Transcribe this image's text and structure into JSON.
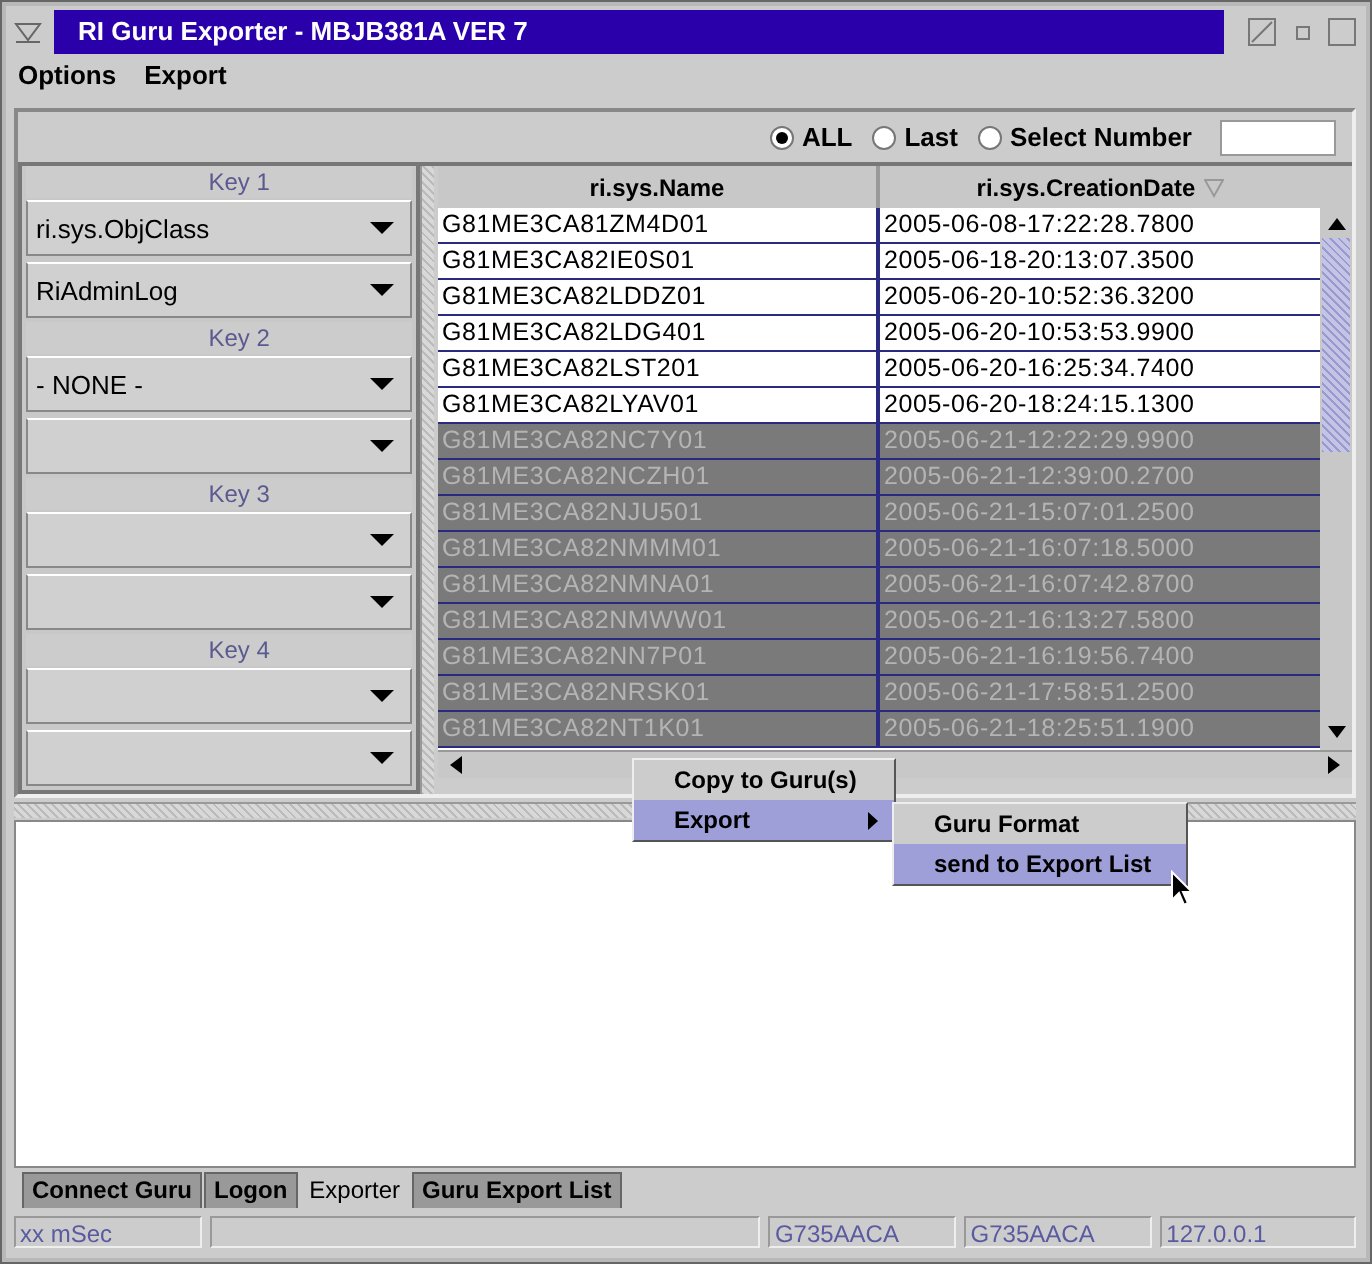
{
  "window": {
    "title": "RI Guru Exporter - MBJB381A  VER 7"
  },
  "menu_bar": [
    "Options",
    "Export"
  ],
  "filter": {
    "options": [
      {
        "label": "ALL",
        "selected": true
      },
      {
        "label": "Last",
        "selected": false
      },
      {
        "label": "Select Number",
        "selected": false
      }
    ]
  },
  "keys": [
    {
      "label": "Key 1",
      "selectors": [
        {
          "kind": "value",
          "value": "ri.sys.ObjClass"
        },
        {
          "kind": "value",
          "value": "RiAdminLog"
        }
      ]
    },
    {
      "label": "Key 2",
      "selectors": [
        {
          "kind": "value",
          "value": "- NONE -"
        },
        {
          "kind": "blank"
        }
      ]
    },
    {
      "label": "Key 3",
      "selectors": [
        {
          "kind": "blank"
        },
        {
          "kind": "blank"
        }
      ]
    },
    {
      "label": "Key 4",
      "selectors": [
        {
          "kind": "blank"
        },
        {
          "kind": "blank"
        }
      ]
    }
  ],
  "table": {
    "columns": [
      {
        "label": "ri.sys.Name",
        "sorted": false
      },
      {
        "label": "ri.sys.CreationDate",
        "sorted": true
      }
    ],
    "rows": [
      {
        "cells": [
          "G81ME3CA81ZM4D01",
          "2005-06-08-17:22:28.7800"
        ],
        "selected": false
      },
      {
        "cells": [
          "G81ME3CA82IE0S01",
          "2005-06-18-20:13:07.3500"
        ],
        "selected": false
      },
      {
        "cells": [
          "G81ME3CA82LDDZ01",
          "2005-06-20-10:52:36.3200"
        ],
        "selected": false
      },
      {
        "cells": [
          "G81ME3CA82LDG401",
          "2005-06-20-10:53:53.9900"
        ],
        "selected": false
      },
      {
        "cells": [
          "G81ME3CA82LST201",
          "2005-06-20-16:25:34.7400"
        ],
        "selected": false
      },
      {
        "cells": [
          "G81ME3CA82LYAV01",
          "2005-06-20-18:24:15.1300"
        ],
        "selected": false
      },
      {
        "cells": [
          "G81ME3CA82NC7Y01",
          "2005-06-21-12:22:29.9900"
        ],
        "selected": true
      },
      {
        "cells": [
          "G81ME3CA82NCZH01",
          "2005-06-21-12:39:00.2700"
        ],
        "selected": true
      },
      {
        "cells": [
          "G81ME3CA82NJU501",
          "2005-06-21-15:07:01.2500"
        ],
        "selected": true
      },
      {
        "cells": [
          "G81ME3CA82NMMM01",
          "2005-06-21-16:07:18.5000"
        ],
        "selected": true
      },
      {
        "cells": [
          "G81ME3CA82NMNA01",
          "2005-06-21-16:07:42.8700"
        ],
        "selected": true
      },
      {
        "cells": [
          "G81ME3CA82NMWW01",
          "2005-06-21-16:13:27.5800"
        ],
        "selected": true
      },
      {
        "cells": [
          "G81ME3CA82NN7P01",
          "2005-06-21-16:19:56.7400"
        ],
        "selected": true
      },
      {
        "cells": [
          "G81ME3CA82NRSK01",
          "2005-06-21-17:58:51.2500"
        ],
        "selected": true
      },
      {
        "cells": [
          "G81ME3CA82NT1K01",
          "2005-06-21-18:25:51.1900"
        ],
        "selected": true
      }
    ]
  },
  "context_menu": {
    "items": [
      {
        "label": "Copy to Guru(s)",
        "selected": false,
        "submenu": false
      },
      {
        "label": "Export",
        "selected": true,
        "submenu": true
      }
    ]
  },
  "submenu": {
    "items": [
      {
        "label": "Guru Format",
        "selected": false
      },
      {
        "label": "send to Export List",
        "selected": true
      }
    ]
  },
  "tabs": [
    {
      "label": "Connect Guru",
      "selected": false
    },
    {
      "label": "Logon",
      "selected": false
    },
    {
      "label": "Exporter",
      "selected": true
    },
    {
      "label": "Guru Export List",
      "selected": false
    }
  ],
  "status_bar": [
    {
      "kind": "text",
      "text": "xx mSec"
    },
    {
      "kind": "blank"
    },
    {
      "kind": "text",
      "text": "G735AACA"
    },
    {
      "kind": "text",
      "text": "G735AACA"
    },
    {
      "kind": "text",
      "text": "127.0.0.1"
    }
  ]
}
